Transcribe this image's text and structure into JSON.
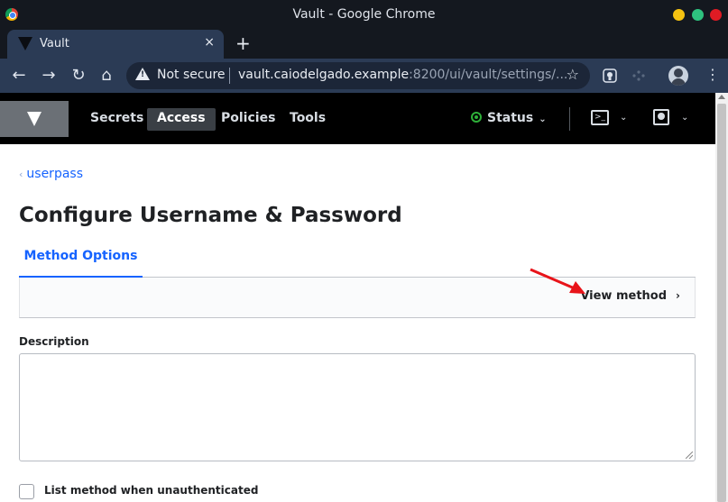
{
  "window": {
    "title": "Vault - Google Chrome"
  },
  "browser": {
    "tab_title": "Vault",
    "tab_close": "×",
    "new_tab": "+",
    "back_icon": "←",
    "forward_icon": "→",
    "reload_icon": "↻",
    "home_icon": "⌂",
    "security_label": "Not secure",
    "url_host": "vault.caiodelgado.example",
    "url_path": ":8200/ui/vault/settings/...",
    "bookmark_icon": "☆",
    "menu_icon": "⋮"
  },
  "vault_nav": {
    "links": [
      "Secrets",
      "Access",
      "Policies",
      "Tools"
    ],
    "active_link": "Access",
    "status_label": "Status",
    "caret": "⌄",
    "console_glyph": ">_"
  },
  "content": {
    "breadcrumb_chevron": "‹",
    "breadcrumb": "userpass",
    "page_title": "Configure Username & Password",
    "tab_label": "Method Options",
    "view_method_label": "View method",
    "view_method_chevron": "›",
    "description_label": "Description",
    "description_value": "",
    "checkbox_label": "List method when unauthenticated",
    "checkbox_checked": false
  },
  "colors": {
    "accent": "#1563ff",
    "nav_bg": "#000000",
    "annotation_arrow": "#e8141a",
    "status_ok": "#2eb039"
  }
}
